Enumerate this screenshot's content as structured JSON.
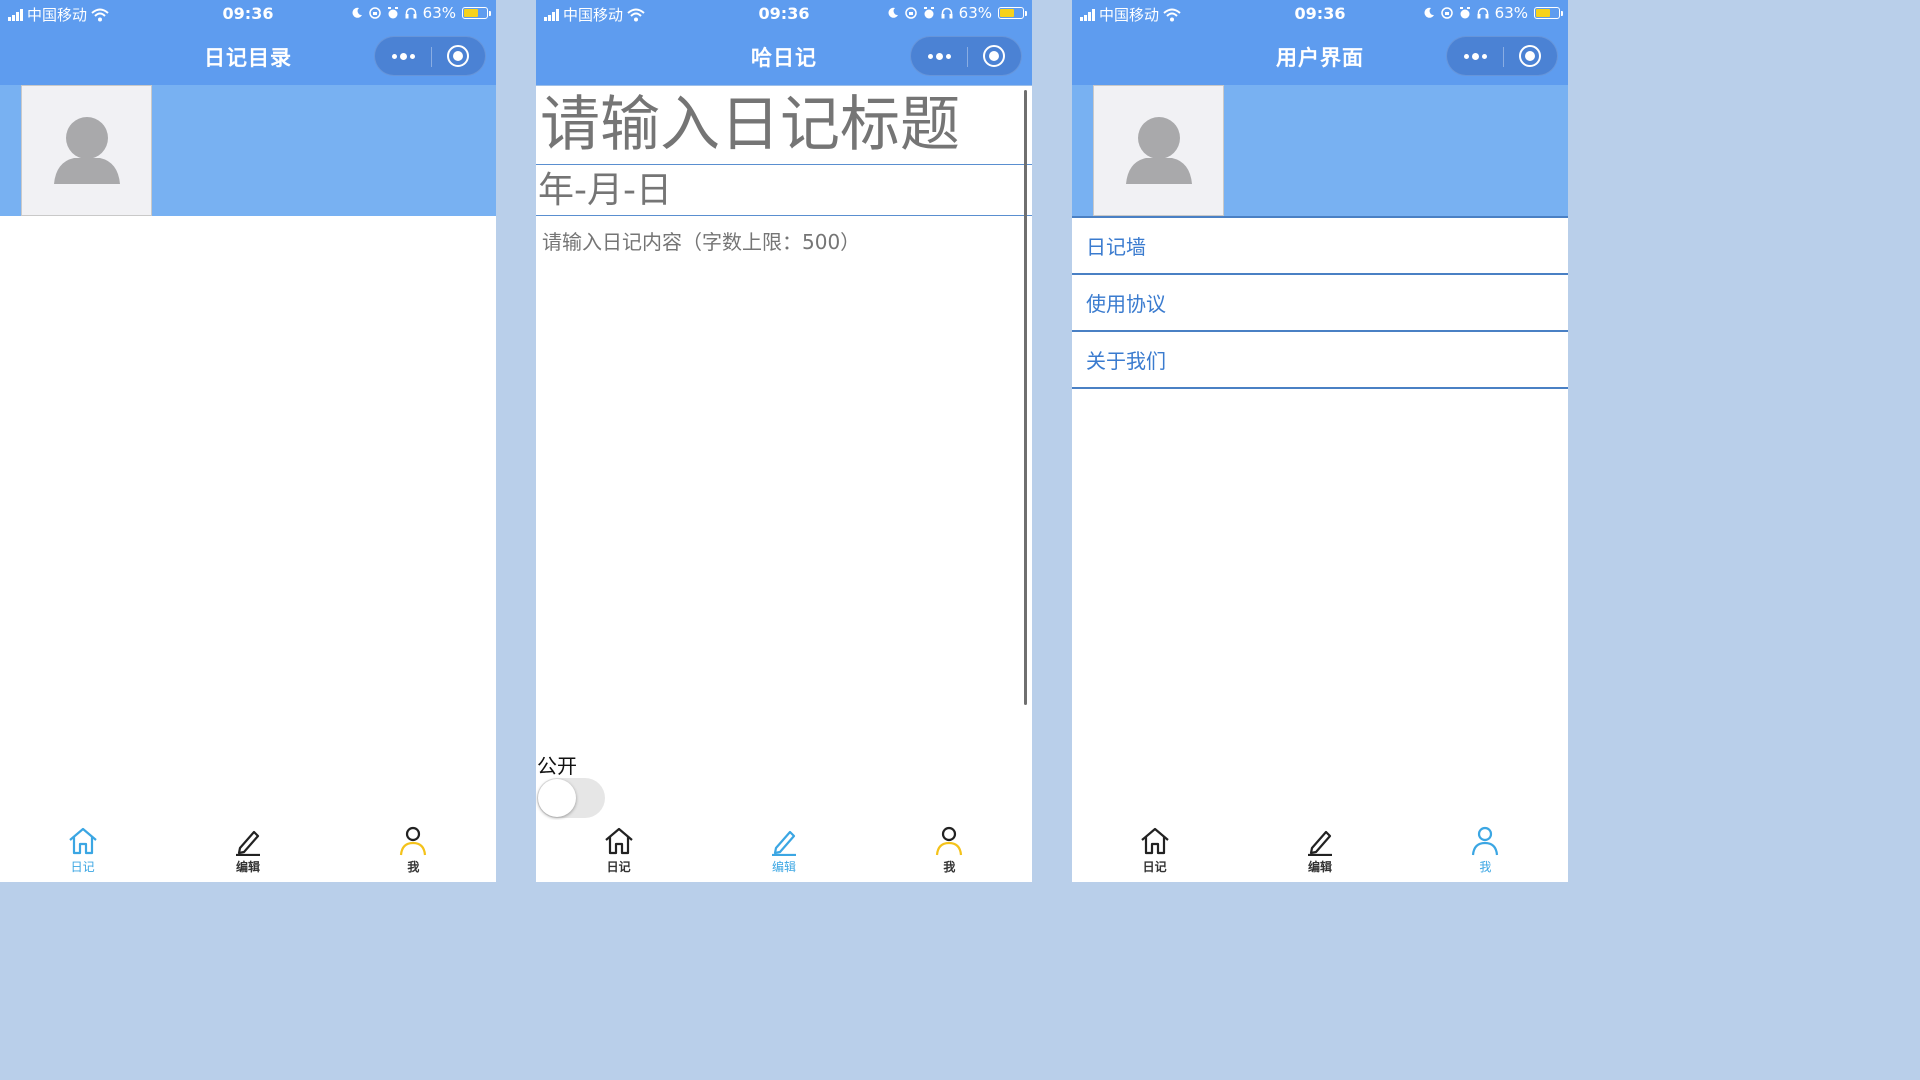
{
  "status_bar": {
    "carrier": "中国移动",
    "time": "09:36",
    "battery": "63%",
    "battery_level": 0.63
  },
  "screens": [
    {
      "nav_title": "日记目录",
      "active_tab": 0
    },
    {
      "nav_title": "哈日记",
      "active_tab": 1,
      "editor": {
        "title_placeholder": "请输入日记标题",
        "date_placeholder": "年-月-日",
        "content_placeholder": "请输入日记内容（字数上限：500）",
        "public_label": "公开",
        "public_enabled": false
      }
    },
    {
      "nav_title": "用户界面",
      "active_tab": 2,
      "menu": [
        {
          "label": "日记墙"
        },
        {
          "label": "使用协议"
        },
        {
          "label": "关于我们"
        }
      ]
    }
  ],
  "tab_bar": [
    {
      "label": "日记",
      "icon": "home-icon"
    },
    {
      "label": "编辑",
      "icon": "pencil-icon"
    },
    {
      "label": "我",
      "icon": "person-icon"
    }
  ],
  "colors": {
    "header": "#5e9cef",
    "banner": "#78b1f2",
    "active_tab": "#3ba6e3",
    "menu_text": "#3a7bcf",
    "gutter": "#b9cfea"
  }
}
